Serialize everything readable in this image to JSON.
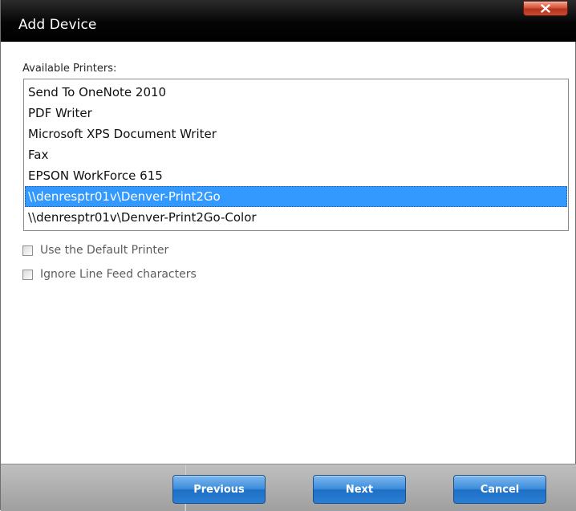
{
  "window": {
    "title": "Add Device",
    "close_icon": "close-x-icon"
  },
  "printers": {
    "label": "Available Printers:",
    "items": [
      "Send To OneNote 2010",
      "PDF Writer",
      "Microsoft XPS Document Writer",
      "Fax",
      "EPSON WorkForce 615",
      "\\\\denresptr01v\\Denver-Print2Go",
      "\\\\denresptr01v\\Denver-Print2Go-Color"
    ],
    "selected_index": 5
  },
  "options": {
    "use_default_printer": {
      "label": "Use the Default Printer",
      "checked": false
    },
    "ignore_line_feed": {
      "label": "Ignore Line Feed characters",
      "checked": false
    }
  },
  "footer": {
    "previous_label": "Previous",
    "next_label": "Next",
    "cancel_label": "Cancel"
  },
  "colors": {
    "selection": "#3399ff",
    "button": "#2a7fd4",
    "close_button": "#c64b31",
    "titlebar": "#000000"
  }
}
